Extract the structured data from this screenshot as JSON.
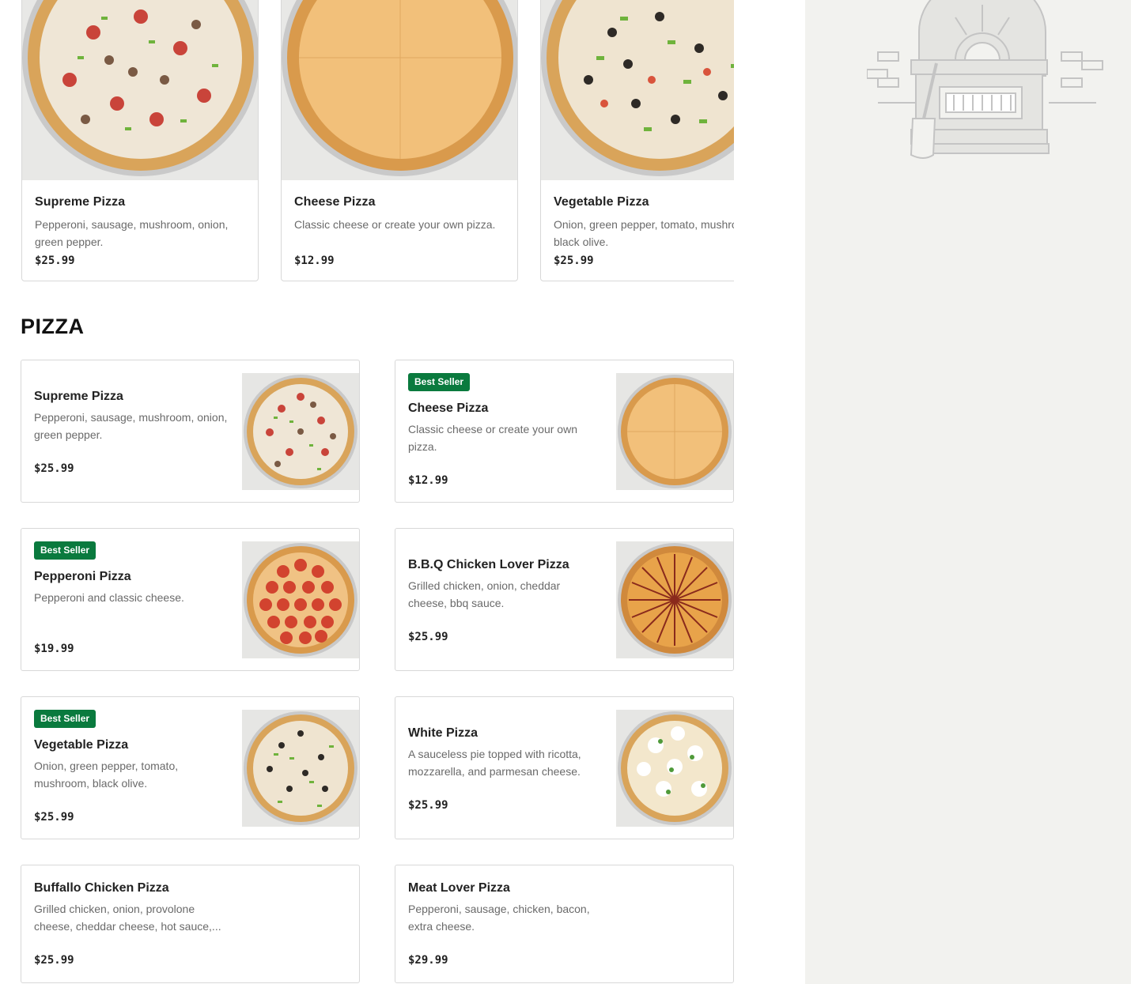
{
  "featured": [
    {
      "name": "Supreme Pizza",
      "description": "Pepperoni, sausage, mushroom, onion, green pepper.",
      "price": "$25.99"
    },
    {
      "name": "Cheese Pizza",
      "description": "Classic cheese or create your own pizza.",
      "price": "$12.99"
    },
    {
      "name": "Vegetable Pizza",
      "description": "Onion, green pepper, tomato, mushroom, black olive.",
      "price": "$25.99"
    }
  ],
  "section": {
    "title": "PIZZA"
  },
  "menu": [
    {
      "name": "Supreme Pizza",
      "description": "Pepperoni, sausage, mushroom, onion, green pepper.",
      "price": "$25.99",
      "badge": ""
    },
    {
      "name": "Cheese Pizza",
      "description": "Classic cheese or create your own pizza.",
      "price": "$12.99",
      "badge": "Best Seller"
    },
    {
      "name": "Pepperoni Pizza",
      "description": "Pepperoni and classic cheese.",
      "price": "$19.99",
      "badge": "Best Seller"
    },
    {
      "name": "B.B.Q Chicken Lover Pizza",
      "description": "Grilled chicken, onion, cheddar cheese, bbq sauce.",
      "price": "$25.99",
      "badge": ""
    },
    {
      "name": "Vegetable Pizza",
      "description": "Onion, green pepper, tomato, mushroom, black olive.",
      "price": "$25.99",
      "badge": "Best Seller"
    },
    {
      "name": "White Pizza",
      "description": "A sauceless pie topped with ricotta, mozzarella, and parmesan cheese.",
      "price": "$25.99",
      "badge": ""
    },
    {
      "name": "Buffallo Chicken Pizza",
      "description": "Grilled chicken, onion, provolone cheese, cheddar cheese, hot sauce,...",
      "price": "$25.99",
      "badge": ""
    },
    {
      "name": "Meat Lover Pizza",
      "description": "Pepperoni, sausage, chicken, bacon, extra cheese.",
      "price": "$29.99",
      "badge": ""
    }
  ],
  "colors": {
    "badge": "#0a7a3e",
    "sidebar": "#f2f2ef",
    "border": "#d8d8d8"
  },
  "icons": {
    "sidebar_illustration": "pizza-oven-icon"
  }
}
